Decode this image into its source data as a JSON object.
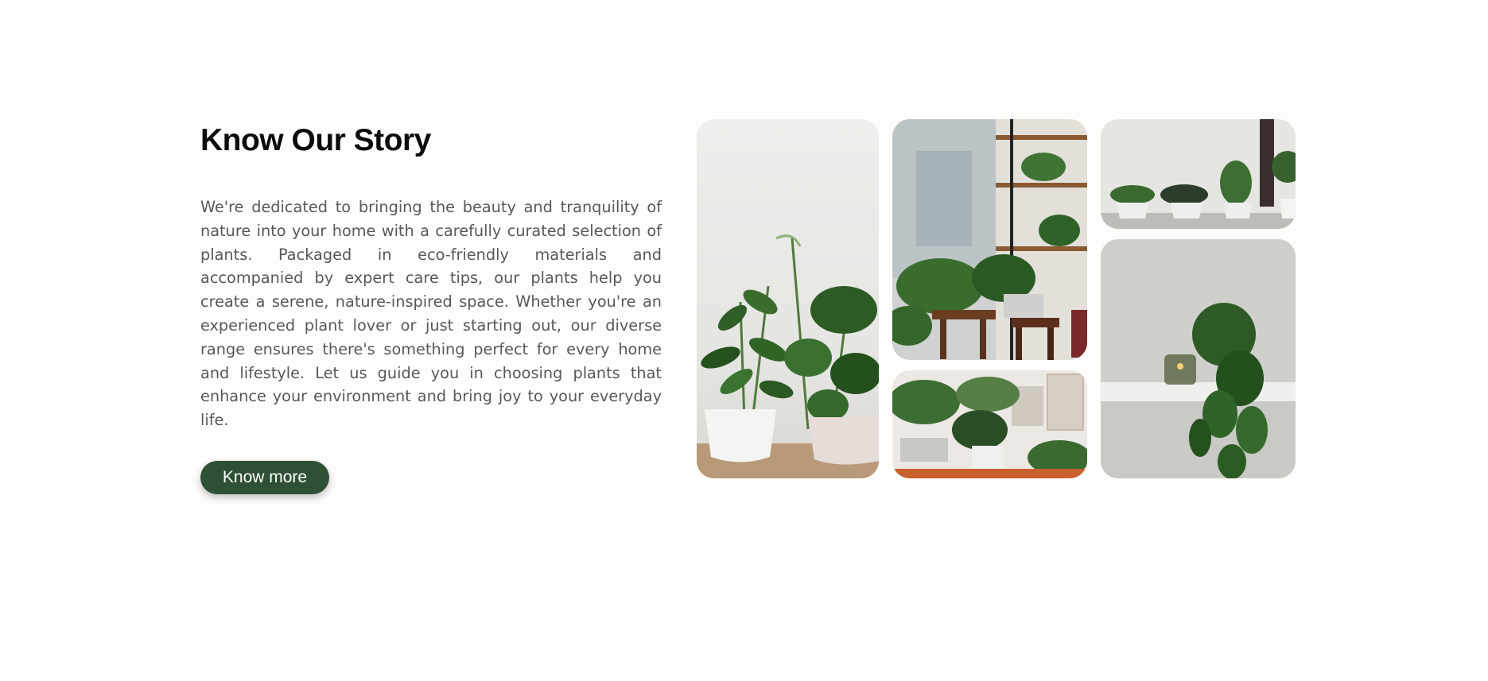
{
  "story": {
    "title": "Know Our Story",
    "body": "We're dedicated to bringing the beauty and tranquility of nature into your home with a carefully curated selection of plants. Packaged in eco-friendly materials and accompanied by expert care tips, our plants help you create a serene, nature-inspired space. Whether you're an experienced plant lover or just starting out, our diverse range ensures there's something perfect for every home and lifestyle. Let us guide you in choosing plants that enhance your environment and bring joy to your everyday life.",
    "button_label": "Know more"
  },
  "colors": {
    "accent": "#2e5034",
    "title": "#0c0c0c",
    "body_text": "#585858",
    "background": "#fffdfc"
  }
}
